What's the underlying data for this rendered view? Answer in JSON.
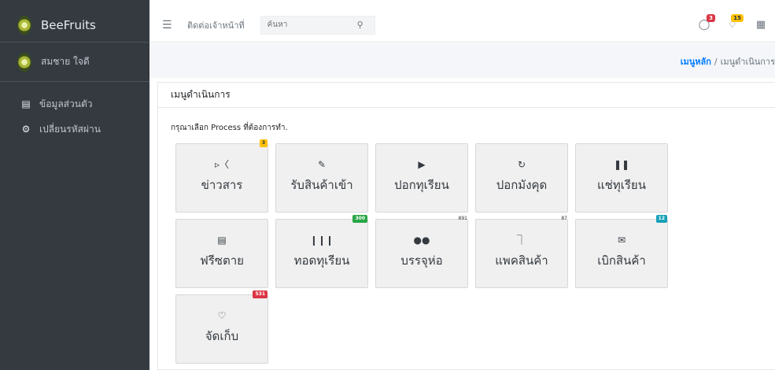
{
  "sidebar": {
    "brand": "BeeFruits",
    "user_name": "สมชาย ใจดี",
    "items": [
      {
        "label": "ข้อมูลส่วนตัว",
        "icon": "id-card-icon"
      },
      {
        "label": "เปลี่ยนรหัสผ่าน",
        "icon": "gear-icon"
      }
    ]
  },
  "topbar": {
    "contact": "ติดต่อเจ้าหน้าที่",
    "search_placeholder": "ค้นหา",
    "messages_count": "3",
    "notifications_count": "15"
  },
  "breadcrumb": {
    "home": "เมนูหลัก",
    "separator": "/",
    "current": "เมนูดำเนินการ"
  },
  "card": {
    "title": "เมนูดำเนินการ",
    "instruction": "กรุณาเลือก Process ที่ต้องการทำ."
  },
  "tiles": [
    {
      "label": "ข่าวสาร",
      "icon": "megaphone-icon",
      "badge": "3",
      "badge_style": "yellow"
    },
    {
      "label": "รับสินค้าเข้า",
      "icon": "edit-icon",
      "badge": "",
      "badge_style": ""
    },
    {
      "label": "ปอกทุเรียน",
      "icon": "play-icon",
      "badge": "",
      "badge_style": ""
    },
    {
      "label": "ปอกมังคุด",
      "icon": "redo-icon",
      "badge": "",
      "badge_style": ""
    },
    {
      "label": "แช่ทุเรียน",
      "icon": "pause-icon",
      "badge": "",
      "badge_style": ""
    },
    {
      "label": "ฟรีซตาย",
      "icon": "save-icon",
      "badge": "",
      "badge_style": ""
    },
    {
      "label": "ทอดทุเรียน",
      "icon": "barcode-icon",
      "badge": "300",
      "badge_style": "green"
    },
    {
      "label": "บรรจุห่อ",
      "icon": "users-icon",
      "badge": "891",
      "badge_style": "plain"
    },
    {
      "label": "แพคสินค้า",
      "icon": "inbox-icon",
      "badge": "87",
      "badge_style": "plain"
    },
    {
      "label": "เบิกสินค้า",
      "icon": "envelope-icon",
      "badge": "12",
      "badge_style": "teal"
    },
    {
      "label": "จัดเก็บ",
      "icon": "heart-icon",
      "badge": "531",
      "badge_style": "red"
    }
  ]
}
